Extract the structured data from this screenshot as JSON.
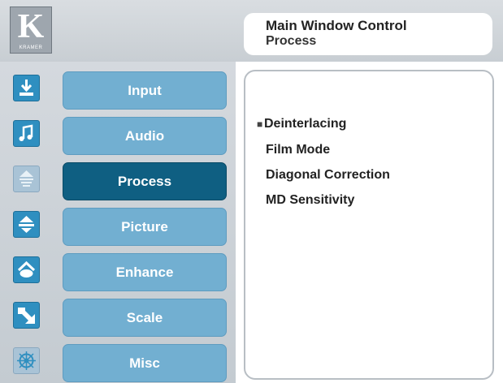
{
  "header": {
    "logo_letter": "K",
    "logo_brand": "KRAMER",
    "title": "Main Window Control",
    "subtitle": "Process"
  },
  "sidebar": {
    "items": [
      {
        "label": "Input",
        "icon": "input-icon"
      },
      {
        "label": "Audio",
        "icon": "audio-icon"
      },
      {
        "label": "Process",
        "icon": "process-icon",
        "active": true
      },
      {
        "label": "Picture",
        "icon": "picture-icon"
      },
      {
        "label": "Enhance",
        "icon": "enhance-icon"
      },
      {
        "label": "Scale",
        "icon": "scale-icon"
      },
      {
        "label": "Misc",
        "icon": "misc-icon"
      }
    ]
  },
  "content": {
    "options": [
      {
        "label": "Deinterlacing",
        "selected": true
      },
      {
        "label": "Film Mode"
      },
      {
        "label": "Diagonal Correction"
      },
      {
        "label": "MD Sensitivity"
      }
    ],
    "selected_marker": "■"
  },
  "colors": {
    "button": "#72afd1",
    "button_active": "#0f5f82",
    "icon_blue": "#2f8fc0"
  }
}
